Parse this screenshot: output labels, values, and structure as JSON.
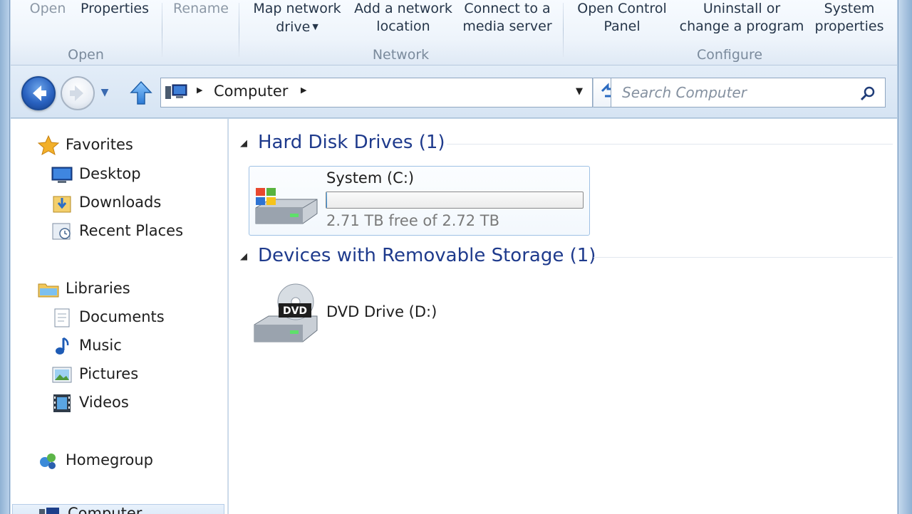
{
  "ribbon": {
    "groups": [
      {
        "label": "Open",
        "buttons": [
          "Open",
          "Properties"
        ]
      },
      {
        "label": "",
        "buttons": [
          "Rename"
        ]
      },
      {
        "label": "Network",
        "buttons": [
          [
            "Map network",
            "drive"
          ],
          [
            "Add a network",
            "location"
          ],
          [
            "Connect to a",
            "media server"
          ]
        ]
      },
      {
        "label": "Configure",
        "buttons": [
          [
            "Open Control",
            "Panel"
          ],
          [
            "Uninstall or",
            "change a program"
          ],
          [
            "System",
            "properties"
          ]
        ]
      }
    ]
  },
  "navbar": {
    "breadcrumb": "Computer",
    "search_placeholder": "Search Computer"
  },
  "navpane": {
    "items": [
      "Favorites",
      "Desktop",
      "Downloads",
      "Recent Places",
      "Libraries",
      "Documents",
      "Music",
      "Pictures",
      "Videos",
      "Homegroup",
      "Computer"
    ]
  },
  "content": {
    "groups": [
      {
        "title": "Hard Disk Drives (1)"
      },
      {
        "title": "Devices with Removable Storage (1)"
      }
    ],
    "drive_c": {
      "name": "System (C:)",
      "free_text": "2.71 TB free of 2.72 TB",
      "used_fraction": 0.004
    },
    "drive_d": {
      "name": "DVD Drive (D:)",
      "badge": "DVD"
    }
  },
  "colors": {
    "group_title": "#1e3a8c",
    "accent": "#2a63c1",
    "frame": "#c4d7ea"
  },
  "icons": [
    "back-icon",
    "forward-icon",
    "up-icon",
    "computer-icon",
    "refresh-icon",
    "search-icon",
    "star-icon",
    "desktop-icon",
    "downloads-icon",
    "recent-places-icon",
    "libraries-icon",
    "documents-icon",
    "music-icon",
    "pictures-icon",
    "videos-icon",
    "homegroup-icon",
    "hard-drive-icon",
    "dvd-drive-icon"
  ]
}
